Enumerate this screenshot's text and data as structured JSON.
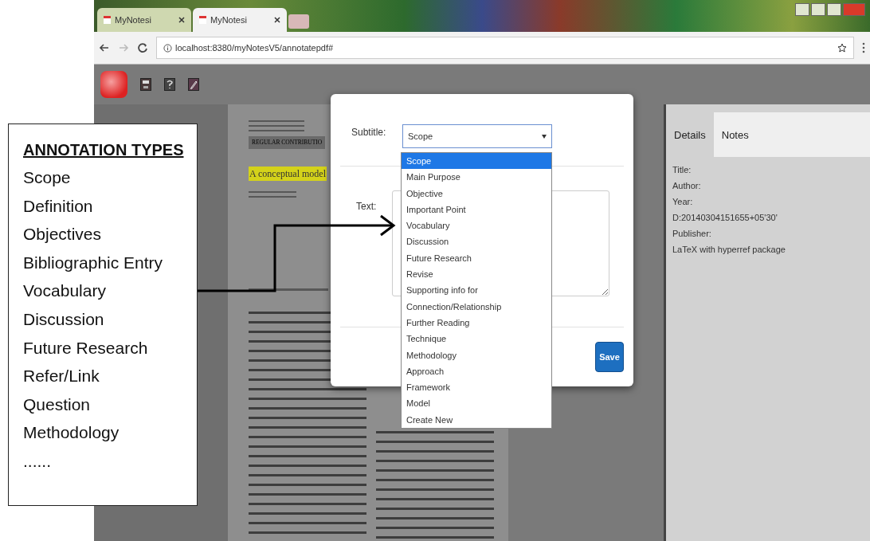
{
  "browser": {
    "tabs": [
      {
        "label": "MyNotesi",
        "selected": false
      },
      {
        "label": "MyNotesi",
        "selected": true
      }
    ],
    "url": "localhost:8380/myNotesV5/annotatepdf#"
  },
  "pdf": {
    "heading_box": "REGULAR CONTRIBUTIO",
    "highlight": "A conceptual model"
  },
  "dialog": {
    "subtitle_label": "Subtitle:",
    "select_value": "Scope",
    "text_label": "Text:",
    "save_button": "Save",
    "options": [
      {
        "label": "Scope",
        "selected": true
      },
      {
        "label": "Main Purpose",
        "selected": false
      },
      {
        "label": "Objective",
        "selected": false
      },
      {
        "label": "Important Point",
        "selected": false
      },
      {
        "label": "Vocabulary",
        "selected": false
      },
      {
        "label": "Discussion",
        "selected": false
      },
      {
        "label": "Future Research",
        "selected": false
      },
      {
        "label": "Revise",
        "selected": false
      },
      {
        "label": "Supporting info for",
        "selected": false
      },
      {
        "label": "Connection/Relationship",
        "selected": false
      },
      {
        "label": "Further Reading",
        "selected": false
      },
      {
        "label": "Technique",
        "selected": false
      },
      {
        "label": "Methodology",
        "selected": false
      },
      {
        "label": "Approach",
        "selected": false
      },
      {
        "label": "Framework",
        "selected": false
      },
      {
        "label": "Model",
        "selected": false
      },
      {
        "label": "Create New",
        "selected": false
      }
    ]
  },
  "side_panel": {
    "tabs": [
      {
        "label": "Details",
        "selected": true
      },
      {
        "label": "Notes",
        "selected": false
      }
    ],
    "lines": [
      "Title:",
      "Author:",
      "Year:",
      "D:20140304151655+05'30'",
      "Publisher:",
      "LaTeX with hyperref package"
    ]
  },
  "annotation_box": {
    "heading": "ANNOTATION TYPES",
    "items": [
      "Scope",
      "Definition",
      "Objectives",
      "Bibliographic Entry",
      "Vocabulary",
      "Discussion",
      "Future Research",
      "Refer/Link",
      "Question",
      "Methodology",
      "......"
    ]
  }
}
